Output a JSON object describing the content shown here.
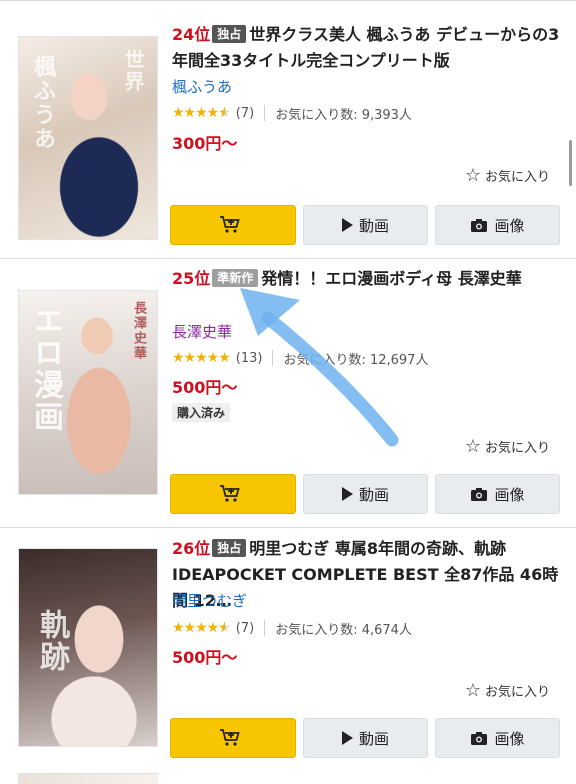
{
  "buttons": {
    "video_label": "動画",
    "image_label": "画像",
    "favorite_label": "お気に入り"
  },
  "items": [
    {
      "rank": "24位",
      "badge": "独占",
      "title": "世界クラス美人 楓ふうあ デビューからの3年間全33タイトル完全コンプリート版",
      "actress": "楓ふうあ",
      "rating": 4.5,
      "review_count": "(7)",
      "favorites": "お気に入り数: 9,393人",
      "price": "300円〜",
      "purchased": ""
    },
    {
      "rank": "25位",
      "badge": "準新作",
      "title": "発情！！エロ漫画ボディ母 長澤史華",
      "actress": "長澤史華",
      "rating": 5,
      "review_count": "(13)",
      "favorites": "お気に入り数: 12,697人",
      "price": "500円〜",
      "purchased": "購入済み"
    },
    {
      "rank": "26位",
      "badge": "独占",
      "title": "明里つむぎ 専属8年間の奇跡、軌跡 IDEAPOCKET COMPLETE BEST 全87作品 46時間 12…",
      "actress": "明里つむぎ",
      "rating": 4.5,
      "review_count": "(7)",
      "favorites": "お気に入り数: 4,674人",
      "price": "500円〜",
      "purchased": ""
    }
  ],
  "colors": {
    "rank_red": "#d10f1e",
    "cart_yellow": "#f7c600",
    "actress_blue": "#1a6dc3",
    "annotation_blue": "#6fb1ee"
  }
}
